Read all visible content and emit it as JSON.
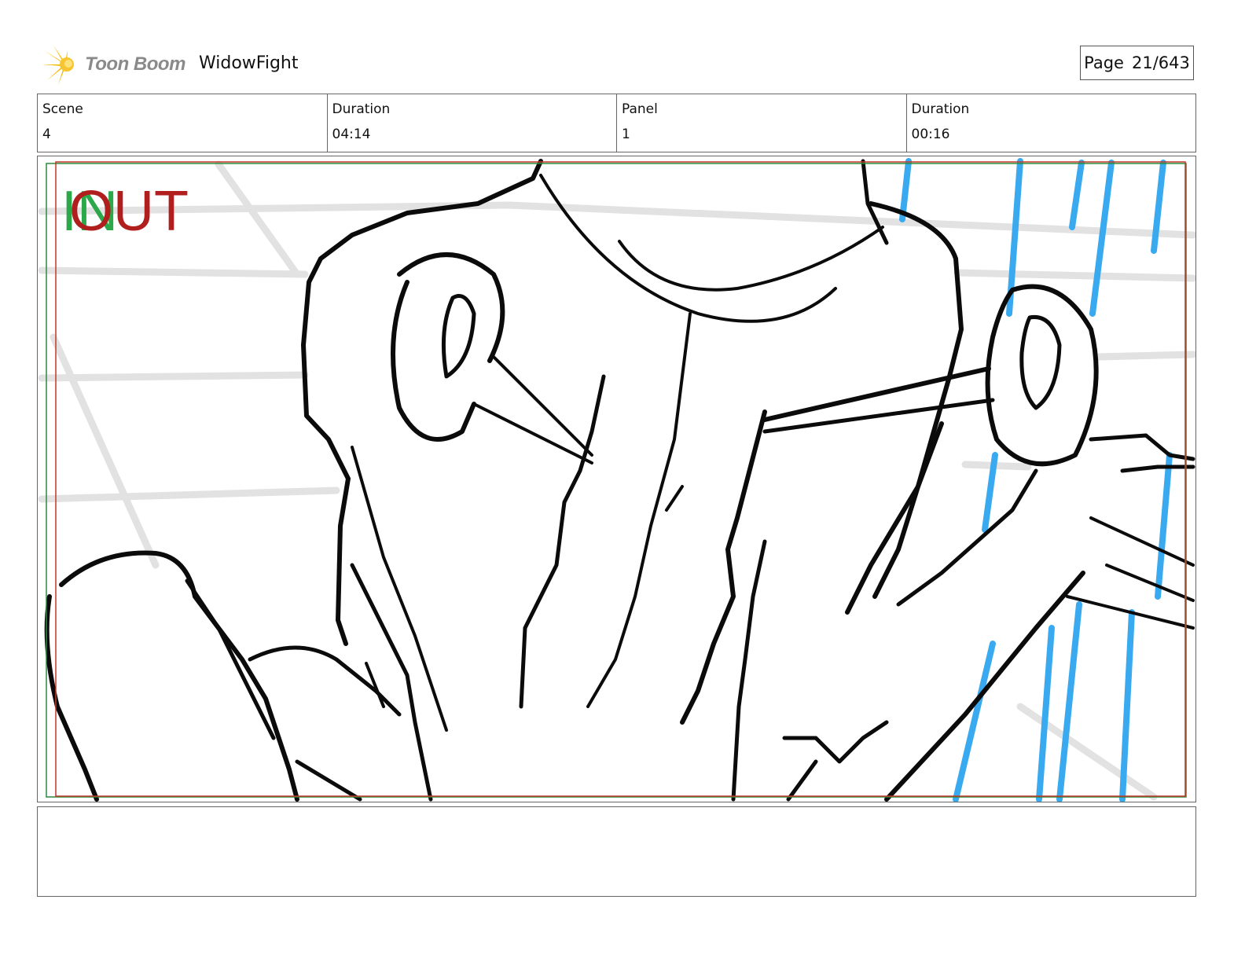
{
  "header": {
    "logo_text": "Toon Boom",
    "project_title": "WidowFight",
    "page_label": "Page",
    "page_value": "21/643"
  },
  "info": {
    "scene_label": "Scene",
    "scene_value": "4",
    "scene_duration_label": "Duration",
    "scene_duration_value": "04:14",
    "panel_label": "Panel",
    "panel_value": "1",
    "panel_duration_label": "Duration",
    "panel_duration_value": "00:16"
  },
  "panel": {
    "in_marker": "IN",
    "out_marker": "OUT",
    "in_color": "#2aa84a",
    "out_color": "#b01e1e",
    "safe_frame_color": "#c0392b",
    "field_guide_color": "#2a8a3a",
    "background_stripes_color": "#3aaaf0"
  },
  "notes": {
    "text": ""
  }
}
